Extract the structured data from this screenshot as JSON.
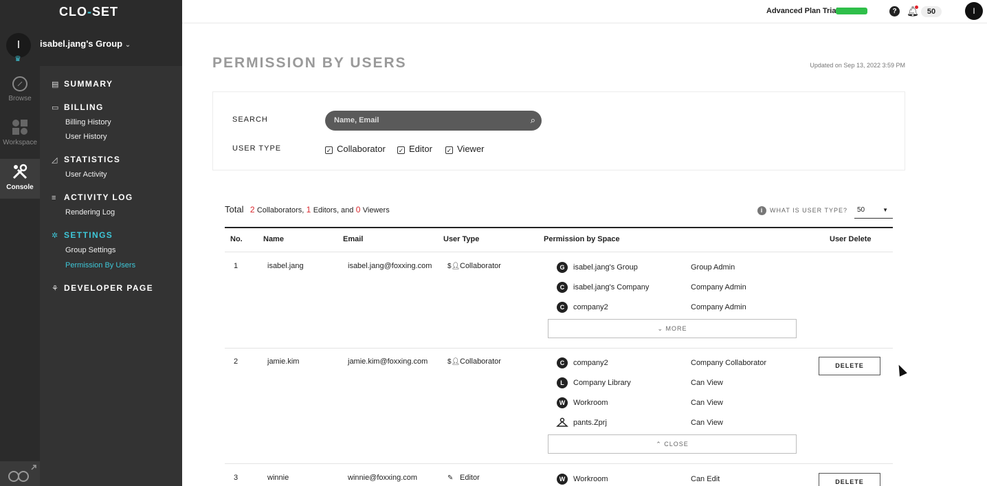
{
  "logo": {
    "part1": "CLO",
    "sep": "-",
    "part2": "SET"
  },
  "group": {
    "avatar_letter": "I",
    "name": "isabel.jang's Group"
  },
  "rail": [
    {
      "label": "Browse",
      "icon": "compass-icon"
    },
    {
      "label": "Workspace",
      "icon": "grid-icon"
    },
    {
      "label": "Console",
      "icon": "tools-icon"
    }
  ],
  "menu": {
    "summary": "SUMMARY",
    "billing": "BILLING",
    "billing_history": "Billing History",
    "user_history": "User History",
    "statistics": "STATISTICS",
    "user_activity": "User Activity",
    "activity_log": "ACTIVITY LOG",
    "rendering_log": "Rendering Log",
    "settings": "SETTINGS",
    "group_settings": "Group Settings",
    "permission_by_users": "Permission By Users",
    "developer_page": "DEVELOPER PAGE"
  },
  "topbar": {
    "plan": "Advanced Plan Trial",
    "help": "?",
    "notif_count": "50",
    "user_letter": "I"
  },
  "page": {
    "title": "PERMISSION BY USERS",
    "updated": "Updated on Sep 13, 2022 3:59 PM"
  },
  "filter": {
    "search_label": "SEARCH",
    "search_placeholder": "Name, Email",
    "user_type_label": "USER TYPE",
    "types": [
      "Collaborator",
      "Editor",
      "Viewer"
    ]
  },
  "summary": {
    "total_label": "Total",
    "collab_count": "2",
    "collab_text": "Collaborators,",
    "editor_count": "1",
    "editor_text": "Editors, and",
    "viewer_count": "0",
    "viewer_text": "Viewers",
    "what_is": "WHAT IS USER TYPE?",
    "per_page": "50"
  },
  "table": {
    "headers": [
      "No.",
      "Name",
      "Email",
      "User Type",
      "Permission by Space",
      "User Delete"
    ],
    "more": "MORE",
    "close": "CLOSE",
    "delete": "DELETE",
    "rows": [
      {
        "no": "1",
        "name": "isabel.jang",
        "email": "isabel.jang@foxxing.com",
        "type": "Collaborator",
        "spaces": [
          {
            "icon": "G",
            "name": "isabel.jang's Group",
            "role": "Group Admin"
          },
          {
            "icon": "C",
            "name": "isabel.jang's Company",
            "role": "Company Admin"
          },
          {
            "icon": "C",
            "name": "company2",
            "role": "Company Admin"
          }
        ]
      },
      {
        "no": "2",
        "name": "jamie.kim",
        "email": "jamie.kim@foxxing.com",
        "type": "Collaborator",
        "spaces": [
          {
            "icon": "C",
            "name": "company2",
            "role": "Company Collaborator"
          },
          {
            "icon": "L",
            "name": "Company Library",
            "role": "Can View"
          },
          {
            "icon": "W",
            "name": "Workroom",
            "role": "Can View"
          },
          {
            "icon": "hanger",
            "name": "pants.Zprj",
            "role": "Can View"
          }
        ]
      },
      {
        "no": "3",
        "name": "winnie",
        "email": "winnie@foxxing.com",
        "type": "Editor",
        "spaces": [
          {
            "icon": "W",
            "name": "Workroom",
            "role": "Can Edit"
          }
        ]
      }
    ]
  }
}
